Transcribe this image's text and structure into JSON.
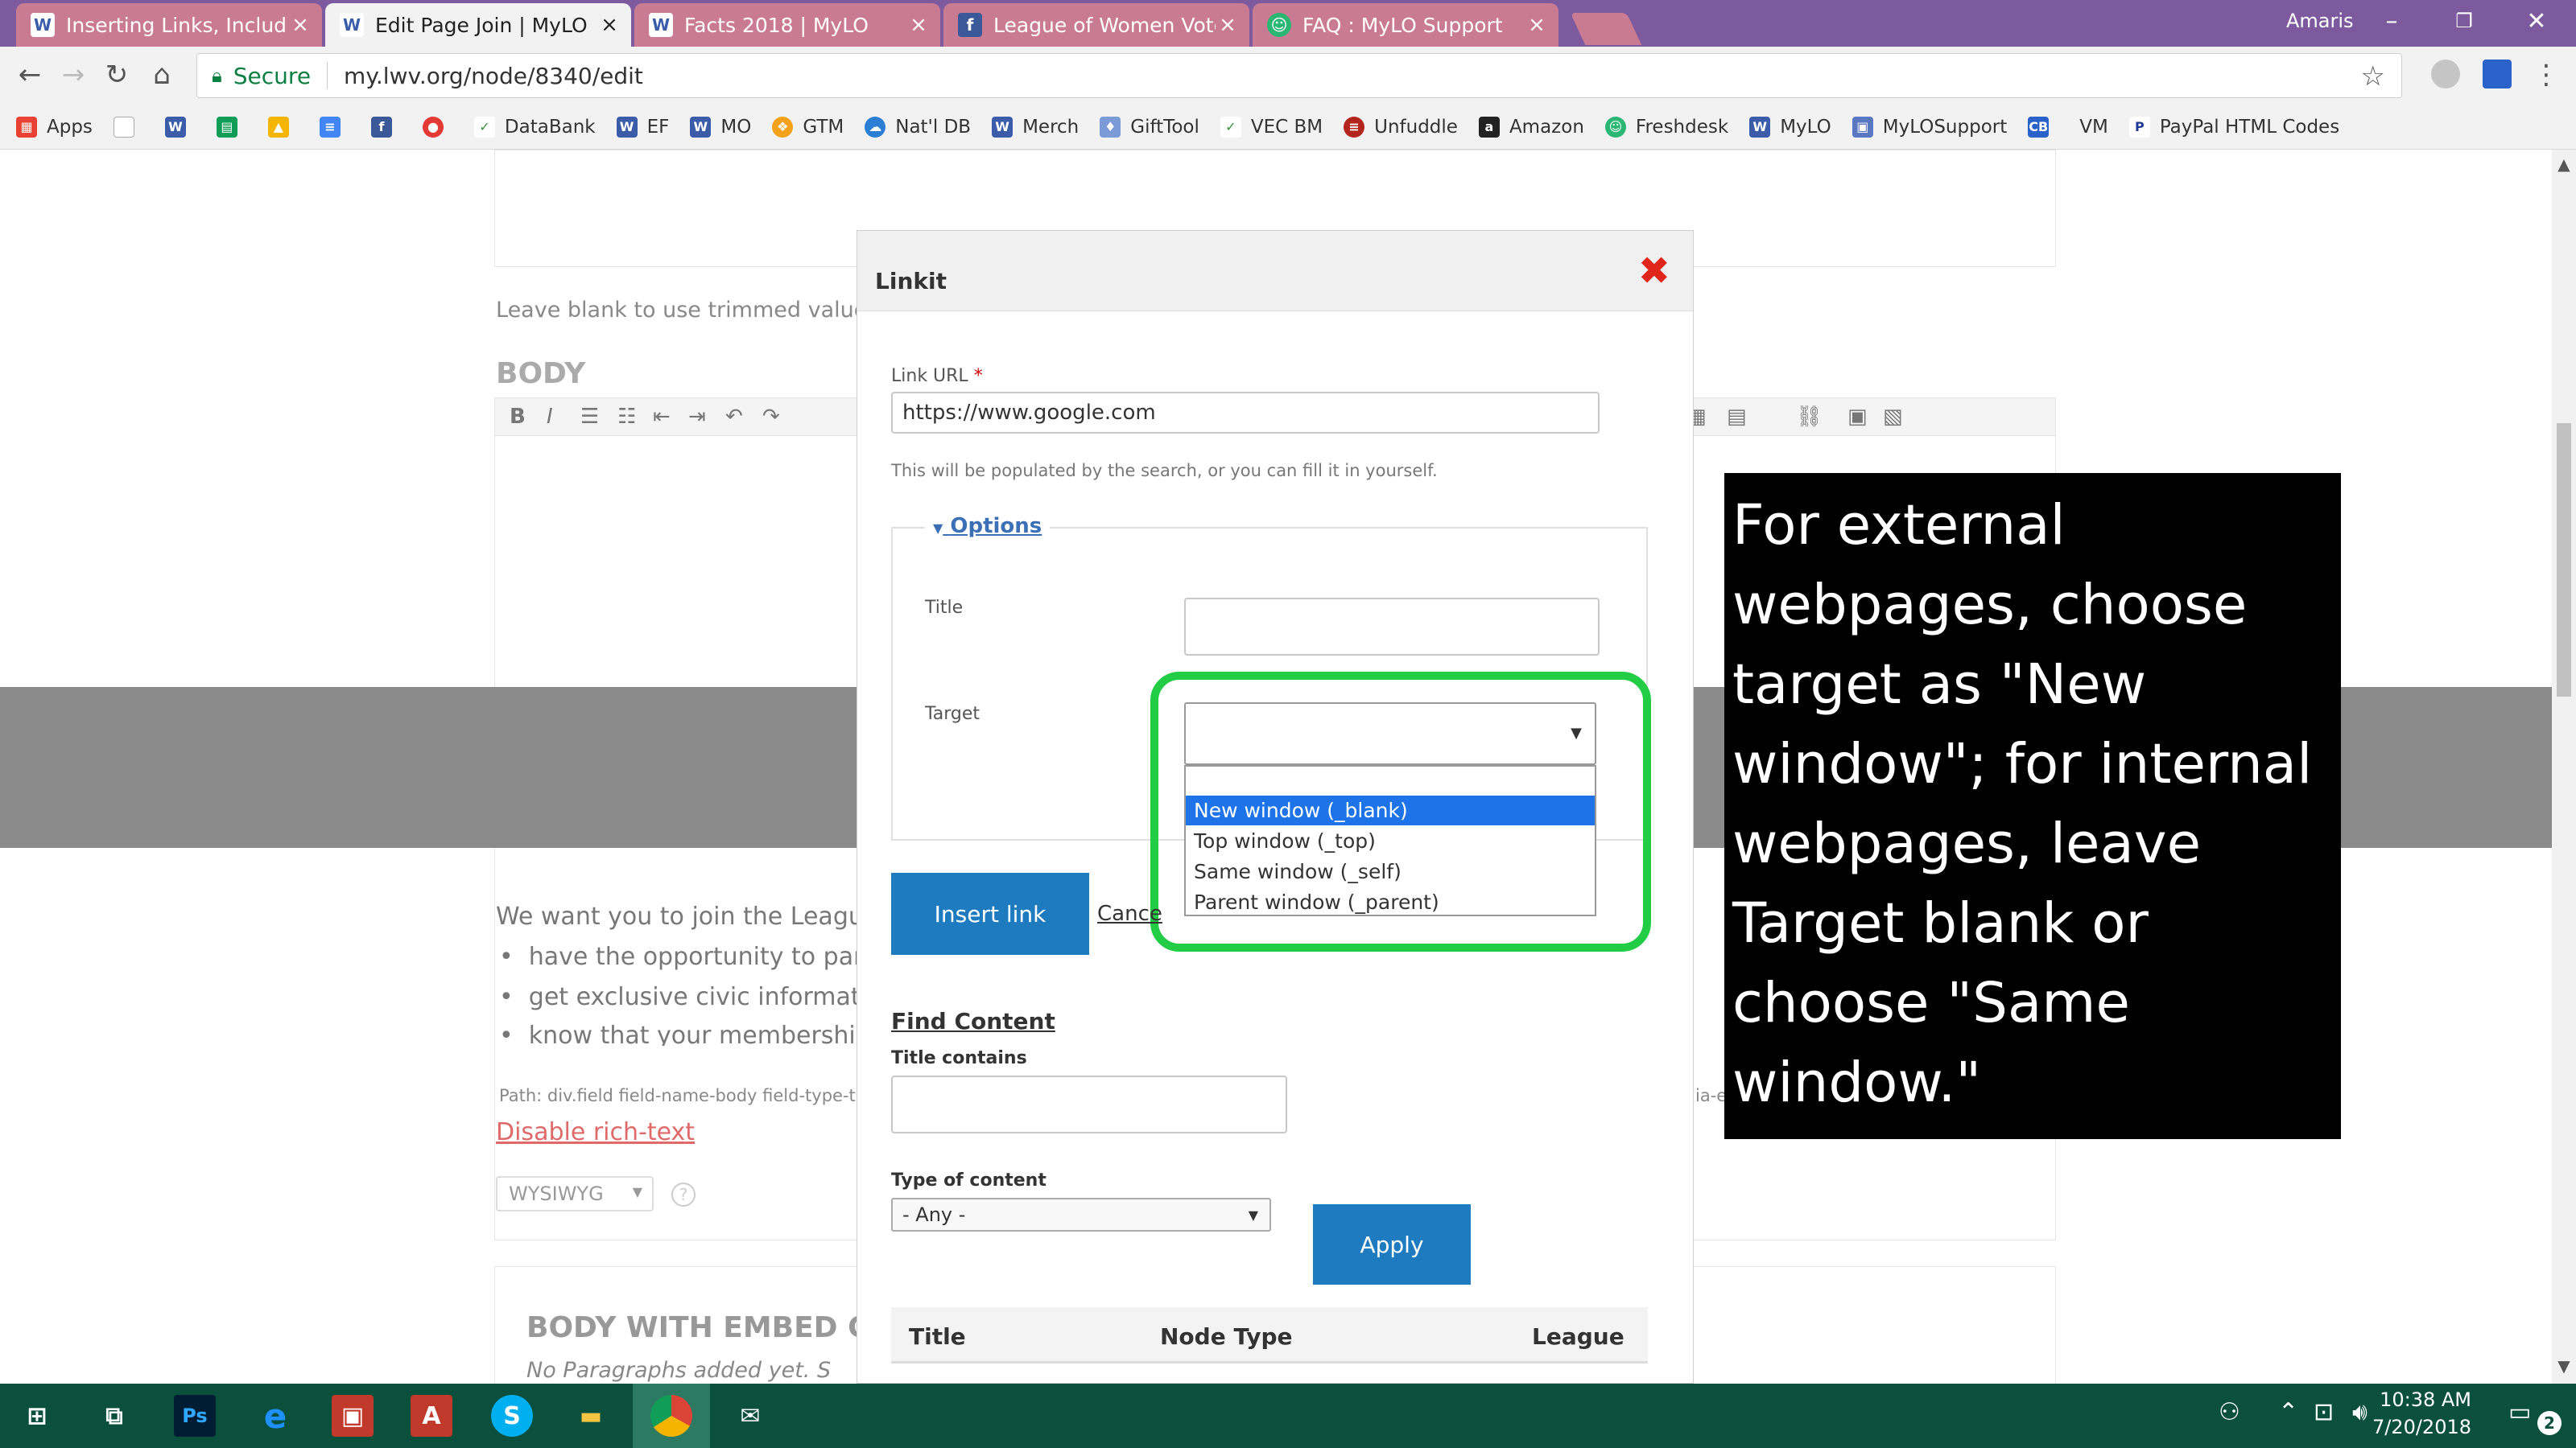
{
  "browser": {
    "tabs": [
      {
        "title": "Inserting Links, Including",
        "favicon": "lwv-logo-icon",
        "active": false
      },
      {
        "title": "Edit Page Join | MyLO",
        "favicon": "lwv-logo-icon",
        "active": true
      },
      {
        "title": "Facts 2018 | MyLO",
        "favicon": "lwv-logo-icon",
        "active": false
      },
      {
        "title": "League of Women Voters",
        "favicon": "facebook-icon",
        "active": false
      },
      {
        "title": "FAQ : MyLO Support",
        "favicon": "freshdesk-icon",
        "active": false
      }
    ],
    "user": "Amaris",
    "address": {
      "secure_label": "Secure",
      "url": "my.lwv.org/node/8340/edit"
    },
    "bookmarks": [
      "Apps",
      "DataBank",
      "EF",
      "MO",
      "GTM",
      "Nat'l DB",
      "Merch",
      "GiftTool",
      "VEC BM",
      "Unfuddle",
      "Amazon",
      "Freshdesk",
      "MyLO",
      "MyLOSupport",
      "VM",
      "PayPal HTML Codes"
    ],
    "bookmark_icon_text": {
      "cb": "CB"
    }
  },
  "page": {
    "trim_help": "Leave blank to use trimmed value of f",
    "body_label": "BODY",
    "body_text": "We want you to join the League",
    "bullets": [
      "have the opportunity to partic",
      "get exclusive civic informatio",
      "know that your membership c"
    ],
    "path_text": "Path: div.field field-name-body field-type-t",
    "path_text_right": "ia-e",
    "disable_rich_text": "Disable rich-text",
    "editor_mode": "WYSIWYG",
    "embed_title": "BODY WITH EMBED C",
    "no_paragraphs": "No Paragraphs added yet. S"
  },
  "modal": {
    "title": "Linkit",
    "link_url_label": "Link URL",
    "required_mark": "*",
    "link_url_value": "https://www.google.com",
    "link_url_help": "This will be populated by the search, or you can fill it in yourself.",
    "options_legend": "Options",
    "title_label": "Title",
    "title_value": "",
    "target_label": "Target",
    "target_value": "",
    "target_options": [
      "New window (_blank)",
      "Top window (_top)",
      "Same window (_self)",
      "Parent window (_parent)"
    ],
    "target_highlighted": "New window (_blank)",
    "insert_label": "Insert link",
    "cancel_label": "Cance",
    "find_content": "Find Content",
    "title_contains_label": "Title contains",
    "type_label": "Type of content",
    "type_value": "- Any -",
    "apply_label": "Apply",
    "columns": [
      "Title",
      "Node Type",
      "League"
    ]
  },
  "annotation": {
    "text": "For external webpages, choose target as \"New window\"; for internal webpages, leave Target blank or choose \"Same window.\""
  },
  "taskbar": {
    "time": "10:38 AM",
    "date": "7/20/2018",
    "notifications": "2"
  },
  "colors": {
    "accent_button": "#1f7bbf",
    "highlight_box": "#22cc44",
    "selected_option": "#1e73e8",
    "close_x": "#e0261b"
  }
}
